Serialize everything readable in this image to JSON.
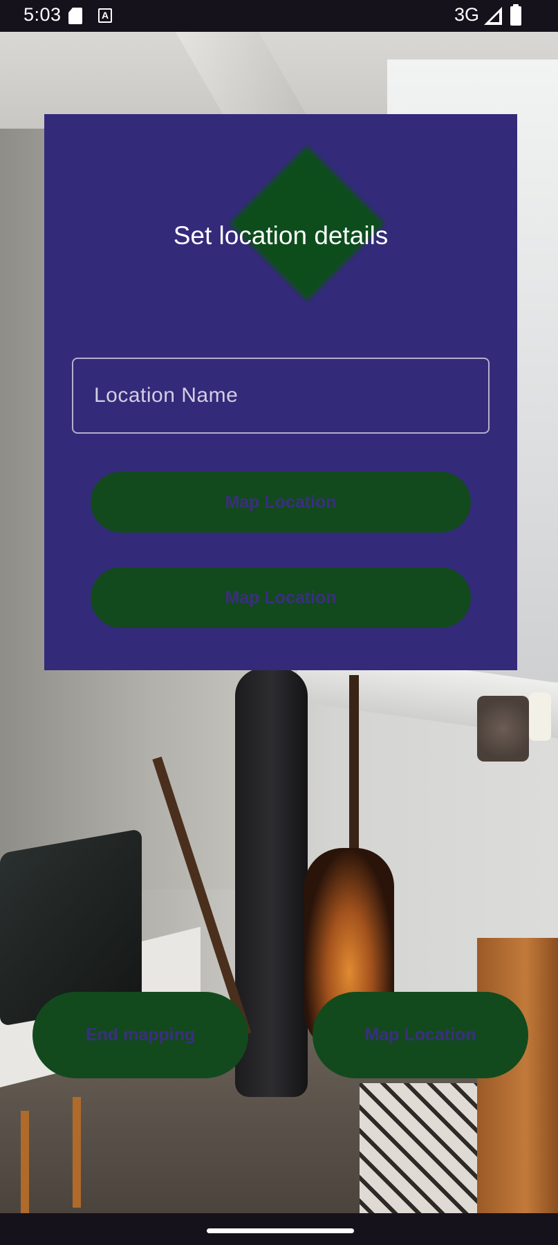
{
  "status_bar": {
    "time": "5:03",
    "network": "3G",
    "icons": [
      "sd-card-icon",
      "text-a-icon",
      "signal-icon",
      "battery-icon"
    ]
  },
  "dialog": {
    "title": "Set location details",
    "location_input": {
      "placeholder": "Location Name",
      "value": ""
    },
    "buttons": [
      {
        "label": "Map Location"
      },
      {
        "label": "Map Location"
      }
    ],
    "decoration_icon": "green-diamond-icon"
  },
  "bottom_actions": {
    "end_mapping_label": "End mapping",
    "map_location_label": "Map Location"
  },
  "colors": {
    "dialog_background": "#342a7a",
    "button_background": "#124a1d",
    "button_text": "#3b2e80",
    "diamond": "#0f4d1b",
    "system_bars": "#15121c"
  }
}
